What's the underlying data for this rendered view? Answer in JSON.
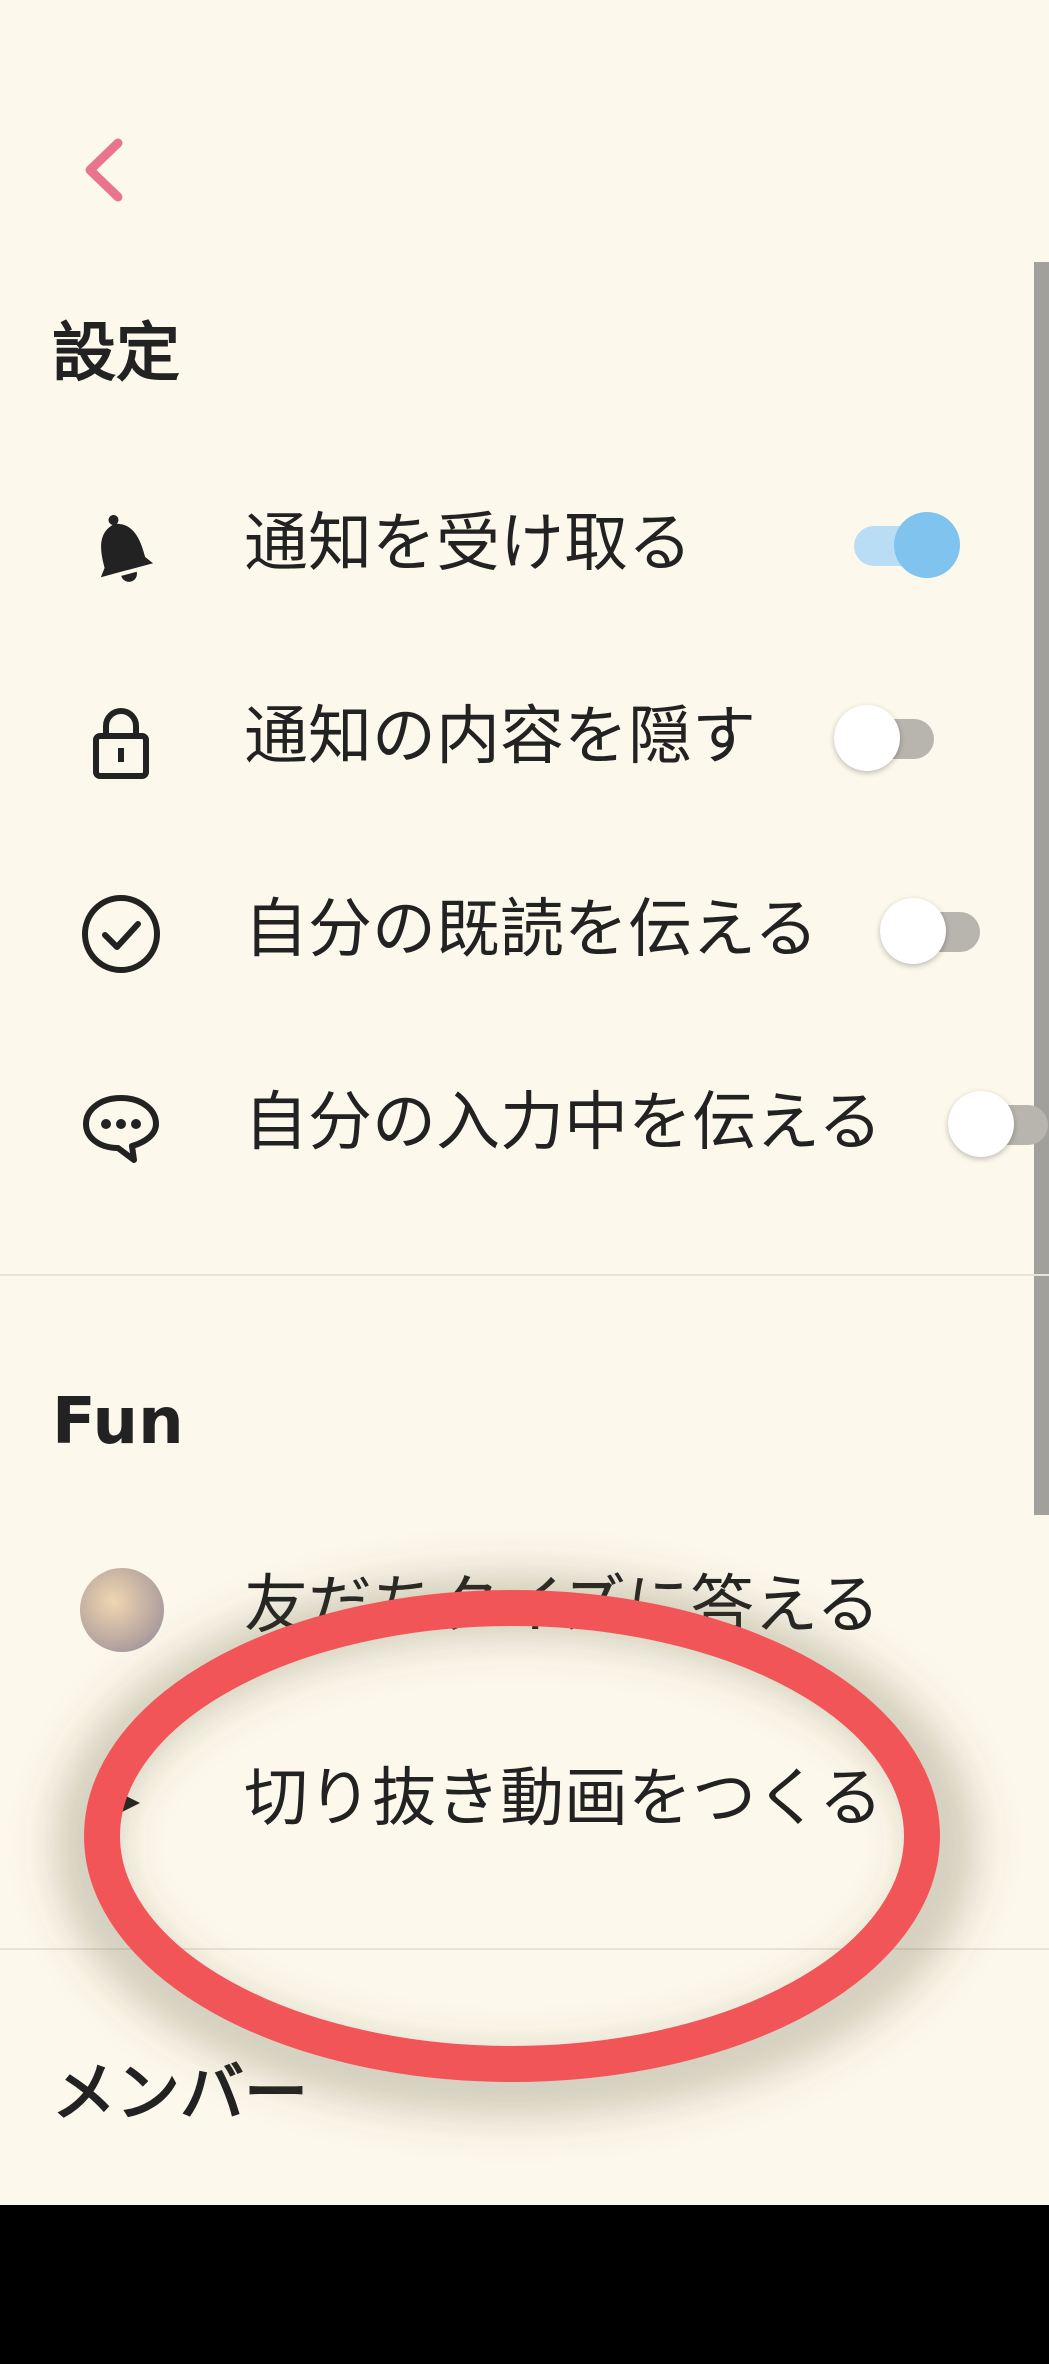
{
  "colors": {
    "background": "#fdf8ec",
    "accent_pink": "#e8758d",
    "toggle_on": "#7fc3ee",
    "toggle_on_track": "#b8ddf4",
    "toggle_off_track": "#b8b5ae",
    "annotation_red": "#f25557"
  },
  "back_icon": "chevron-left-icon",
  "settings": {
    "title": "設定",
    "items": [
      {
        "label": "通知を受け取る",
        "icon": "bell-icon",
        "on": true
      },
      {
        "label": "通知の内容を隠す",
        "icon": "lock-icon",
        "on": false
      },
      {
        "label": "自分の既読を伝える",
        "icon": "check-circle-icon",
        "on": false
      },
      {
        "label": "自分の入力中を伝える",
        "icon": "chat-bubble-icon",
        "on": false
      }
    ]
  },
  "fun": {
    "title": "Fun",
    "items": [
      {
        "label": "友だちクイズに答える",
        "icon": "avatar"
      },
      {
        "label": "切り抜き動画をつくる",
        "icon": "video-icon"
      }
    ]
  },
  "members": {
    "title": "メンバー"
  }
}
